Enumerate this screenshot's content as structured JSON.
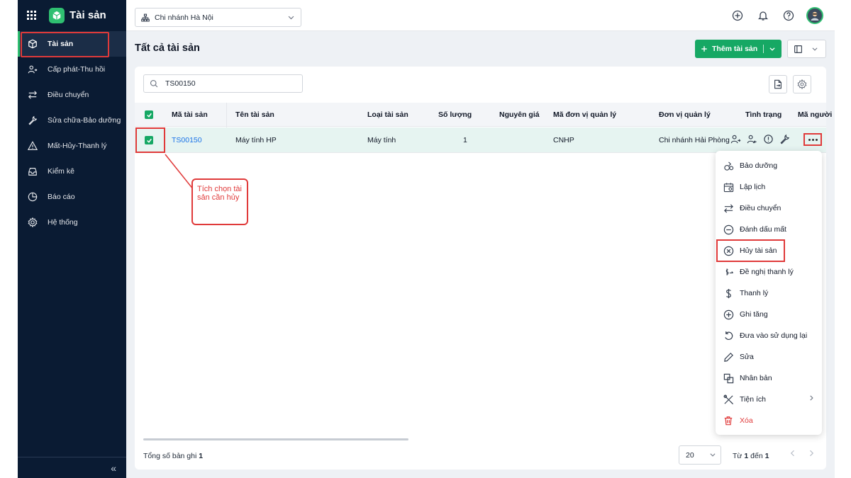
{
  "app": {
    "title": "Tài sản"
  },
  "sidebar": {
    "items": [
      {
        "label": "Tài sản",
        "icon": "box-icon"
      },
      {
        "label": "Cấp phát-Thu hồi",
        "icon": "user-transfer-icon"
      },
      {
        "label": "Điều chuyển",
        "icon": "arrows-swap-icon"
      },
      {
        "label": "Sửa chữa-Bảo dưỡng",
        "icon": "wrench-icon"
      },
      {
        "label": "Mất-Hủy-Thanh lý",
        "icon": "warning-icon"
      },
      {
        "label": "Kiểm kê",
        "icon": "inbox-icon"
      },
      {
        "label": "Báo cáo",
        "icon": "pie-chart-icon"
      },
      {
        "label": "Hệ thống",
        "icon": "gear-icon"
      }
    ],
    "collapse_label": "«"
  },
  "header": {
    "branch": "Chi nhánh Hà Nội"
  },
  "page": {
    "title": "Tất cả tài sản",
    "add_button": "Thêm tài sản"
  },
  "search": {
    "value": "TS00150"
  },
  "table": {
    "columns": [
      "Mã tài sản",
      "Tên tài sản",
      "Loại tài sản",
      "Số lượng",
      "Nguyên giá",
      "Mã đơn vị quản lý",
      "Đơn vị quản lý",
      "Tình trạng",
      "Mã người"
    ],
    "rows": [
      {
        "code": "TS00150",
        "name": "Máy tính HP",
        "type": "Máy tính",
        "quantity": "1",
        "cost": "",
        "unit_code": "CNHP",
        "unit": "Chi nhánh Hải Phòng"
      }
    ]
  },
  "footer": {
    "total_label": "Tổng số bản ghi",
    "total_value": "1",
    "page_size": "20",
    "range_prefix": "Từ",
    "range_from": "1",
    "range_mid": "đến",
    "range_to": "1"
  },
  "callout": {
    "text": "Tích chọn tài sản cần hủy"
  },
  "menu": {
    "items": [
      {
        "label": "Bảo dưỡng",
        "icon": "maintenance-icon"
      },
      {
        "label": "Lập lịch",
        "icon": "calendar-icon"
      },
      {
        "label": "Điều chuyển",
        "icon": "arrows-swap-icon"
      },
      {
        "label": "Đánh dấu mất",
        "icon": "minus-circle-icon"
      },
      {
        "label": "Hủy tài sản",
        "icon": "x-circle-icon"
      },
      {
        "label": "Đề nghị thanh lý",
        "icon": "dollar-request-icon"
      },
      {
        "label": "Thanh lý",
        "icon": "dollar-icon"
      },
      {
        "label": "Ghi tăng",
        "icon": "plus-circle-icon"
      },
      {
        "label": "Đưa vào sử dụng lại",
        "icon": "undo-icon"
      },
      {
        "label": "Sửa",
        "icon": "pencil-icon"
      },
      {
        "label": "Nhân bản",
        "icon": "copy-icon"
      },
      {
        "label": "Tiện ích",
        "icon": "tools-icon"
      },
      {
        "label": "Xóa",
        "icon": "trash-icon"
      }
    ]
  },
  "colors": {
    "brand": "#16a864",
    "sidebar": "#0a1b33",
    "highlight": "#e03a3a",
    "link": "#1a73e8"
  }
}
